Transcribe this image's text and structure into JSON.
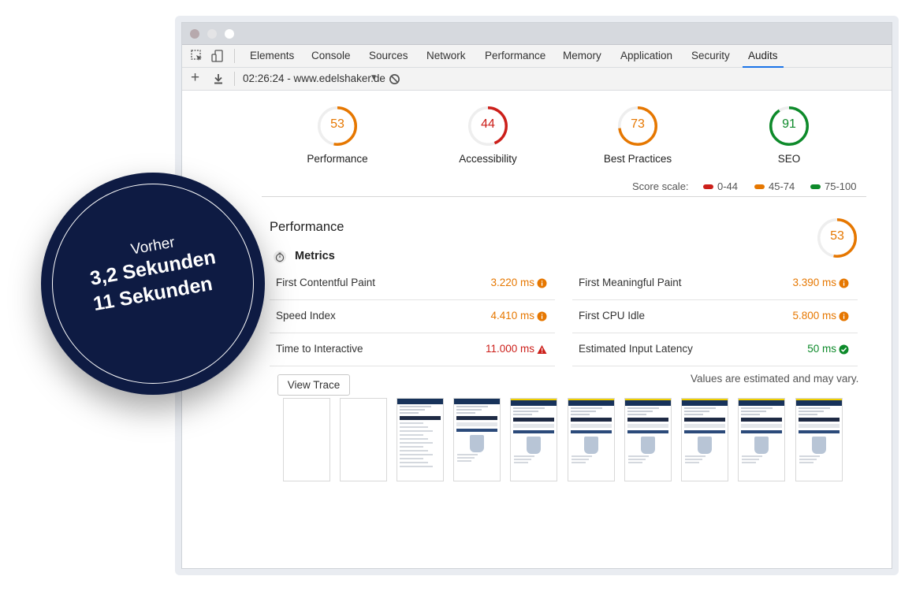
{
  "devtools": {
    "tabs": [
      "Elements",
      "Console",
      "Sources",
      "Network",
      "Performance",
      "Memory",
      "Application",
      "Security",
      "Audits"
    ],
    "active_tab": "Audits",
    "audit_run_label": "02:26:24 - www.edelshaker.de"
  },
  "scores": [
    {
      "value": "53",
      "label": "Performance",
      "fraction": 0.53,
      "color": "#e67700"
    },
    {
      "value": "44",
      "label": "Accessibility",
      "fraction": 0.44,
      "color": "#cc1f1a"
    },
    {
      "value": "73",
      "label": "Best Practices",
      "fraction": 0.73,
      "color": "#e67700"
    },
    {
      "value": "91",
      "label": "SEO",
      "fraction": 0.91,
      "color": "#0d8a2a"
    }
  ],
  "score_scale": {
    "label": "Score scale:",
    "ranges": [
      {
        "label": "0-44",
        "color": "#cc1f1a"
      },
      {
        "label": "45-74",
        "color": "#e67700"
      },
      {
        "label": "75-100",
        "color": "#0d8a2a"
      }
    ]
  },
  "performance": {
    "title": "Performance",
    "score": "53",
    "score_fraction": 0.53,
    "metrics_title": "Metrics",
    "metrics": [
      {
        "name": "First Contentful Paint",
        "value": "3.220 ms",
        "status": "average",
        "icon": "info-circle-icon"
      },
      {
        "name": "First Meaningful Paint",
        "value": "3.390 ms",
        "status": "average",
        "icon": "info-circle-icon"
      },
      {
        "name": "Speed Index",
        "value": "4.410 ms",
        "status": "average",
        "icon": "info-circle-icon"
      },
      {
        "name": "First CPU Idle",
        "value": "5.800 ms",
        "status": "average",
        "icon": "info-circle-icon"
      },
      {
        "name": "Time to Interactive",
        "value": "11.000 ms",
        "status": "fail",
        "icon": "warning-triangle-icon"
      },
      {
        "name": "Estimated Input Latency",
        "value": "50 ms",
        "status": "pass",
        "icon": "check-circle-icon"
      }
    ],
    "view_trace_label": "View Trace",
    "estimate_note": "Values are estimated and may vary."
  },
  "badge": {
    "line1": "Vorher",
    "line2": "3,2 Sekunden",
    "line3": "11 Sekunden"
  },
  "colors": {
    "average": "#e67700",
    "fail": "#cc1f1a",
    "pass": "#0d8a2a",
    "badge_bg": "#0e1b43"
  }
}
